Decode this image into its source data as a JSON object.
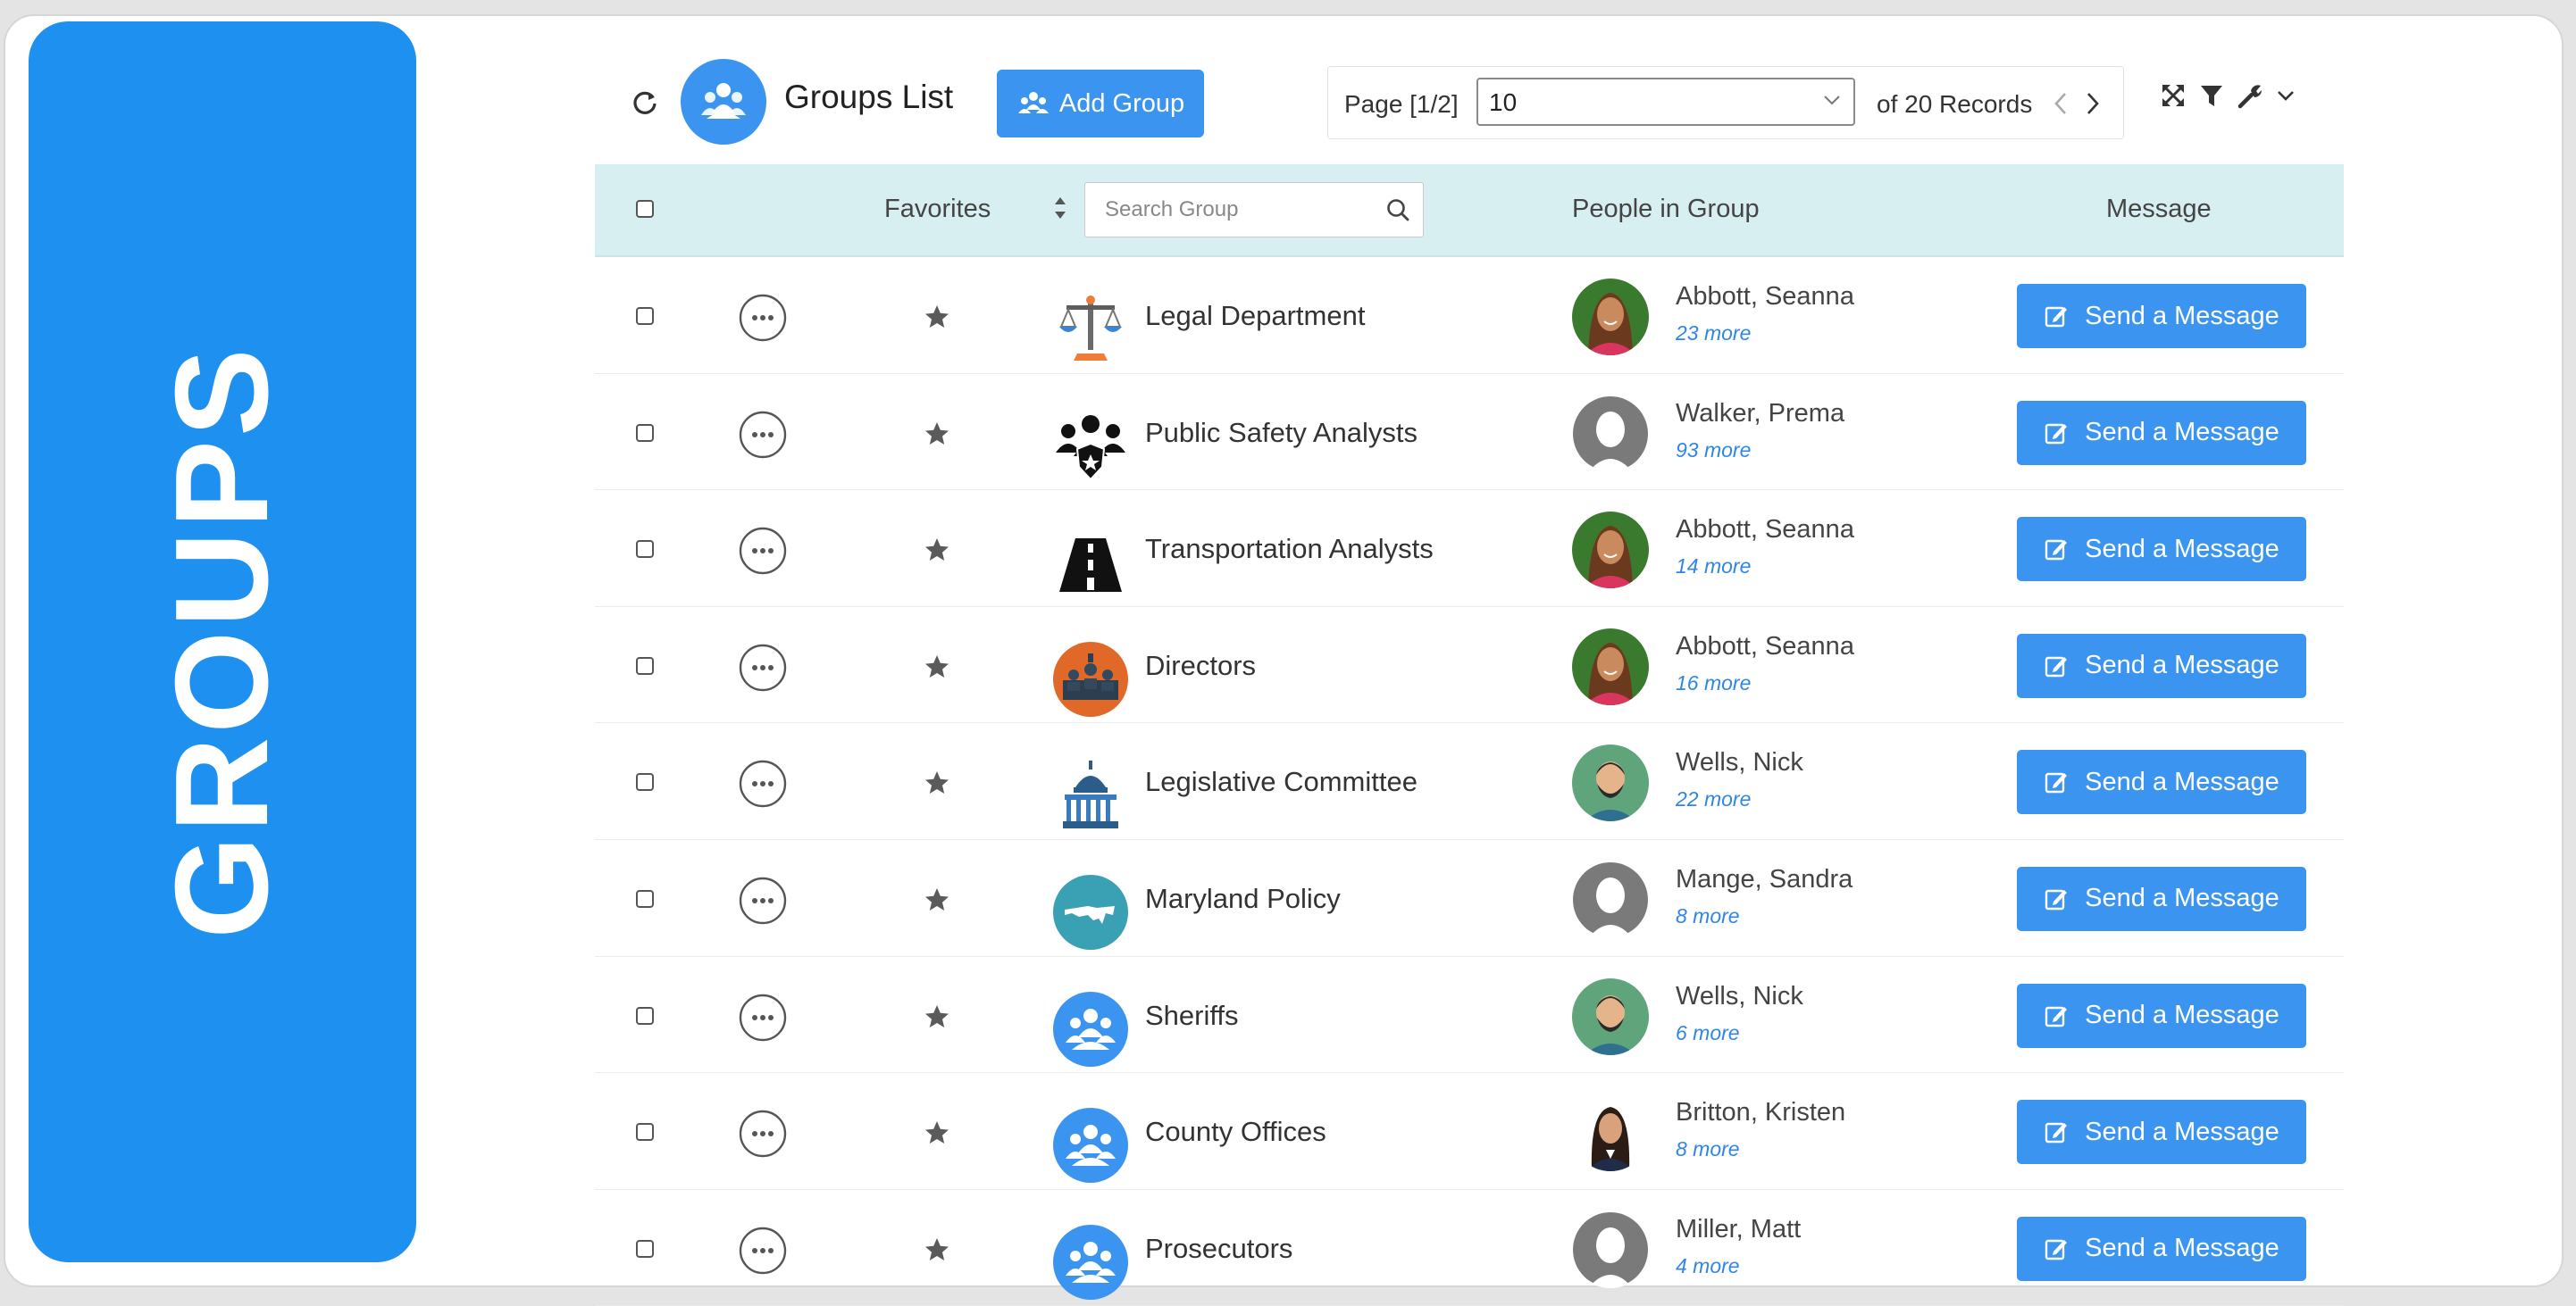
{
  "side_panel": {
    "title": "GROUPS"
  },
  "toolbar": {
    "refresh_icon": "refresh-icon",
    "title": "Groups List",
    "add_group_label": "Add Group",
    "pager": {
      "page_label": "Page [1/2]",
      "page_size": "10",
      "total_label": "of 20 Records"
    },
    "tools": [
      "expand-icon",
      "filter-icon",
      "wrench-icon",
      "chevron-down-icon"
    ]
  },
  "table": {
    "headers": {
      "favorites": "Favorites",
      "search_placeholder": "Search Group",
      "people": "People in Group",
      "message": "Message"
    },
    "send_label": "Send a Message",
    "rows": [
      {
        "group": "Legal Department",
        "group_icon": "scales-icon",
        "person": "Abbott, Seanna",
        "more": "23 more",
        "avatar": "woman-smiling"
      },
      {
        "group": "Public Safety Analysts",
        "group_icon": "police-badge-group-icon",
        "person": "Walker, Prema",
        "more": "93 more",
        "avatar": "placeholder"
      },
      {
        "group": "Transportation Analysts",
        "group_icon": "road-icon",
        "person": "Abbott, Seanna",
        "more": "14 more",
        "avatar": "woman-smiling"
      },
      {
        "group": "Directors",
        "group_icon": "directors-icon",
        "person": "Abbott, Seanna",
        "more": "16 more",
        "avatar": "woman-smiling"
      },
      {
        "group": "Legislative Committee",
        "group_icon": "capitol-icon",
        "person": "Wells, Nick",
        "more": "22 more",
        "avatar": "man-beard"
      },
      {
        "group": "Maryland Policy",
        "group_icon": "maryland-map-icon",
        "person": "Mange, Sandra",
        "more": "8 more",
        "avatar": "placeholder"
      },
      {
        "group": "Sheriffs",
        "group_icon": "people-group-icon",
        "person": "Wells, Nick",
        "more": "6 more",
        "avatar": "man-beard"
      },
      {
        "group": "County Offices",
        "group_icon": "people-group-icon",
        "person": "Britton, Kristen",
        "more": "8 more",
        "avatar": "woman-dark-hair"
      },
      {
        "group": "Prosecutors",
        "group_icon": "people-group-icon",
        "person": "Miller, Matt",
        "more": "4 more",
        "avatar": "placeholder"
      }
    ]
  },
  "colors": {
    "accent": "#3b95f0",
    "side_panel": "#1e90f0",
    "header_bg": "#d8eff1",
    "link": "#2f86e6"
  }
}
